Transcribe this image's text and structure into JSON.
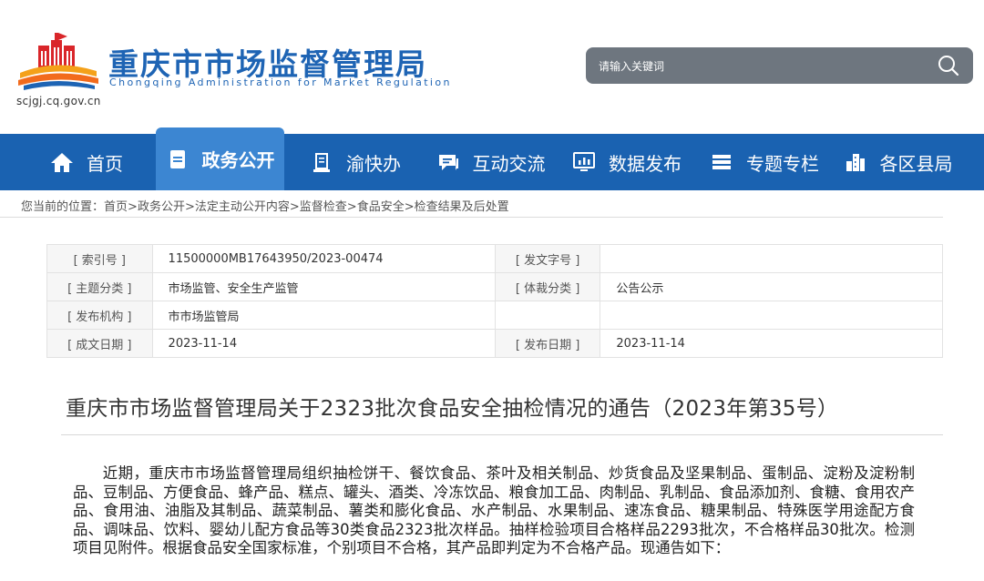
{
  "header": {
    "site_title": "重庆市市场监督管理局",
    "site_subtitle": "Chongqing Administration for Market Regulation",
    "site_url": "scjgj.cq.gov.cn",
    "search_placeholder": "请输入关键词",
    "search_icon": "search-icon"
  },
  "nav": {
    "items": [
      {
        "label": "首页",
        "icon": "home-icon"
      },
      {
        "label": "政务公开",
        "icon": "document-icon",
        "active": true
      },
      {
        "label": "渝快办",
        "icon": "book-icon"
      },
      {
        "label": "互动交流",
        "icon": "chat-icon"
      },
      {
        "label": "数据发布",
        "icon": "monitor-chart-icon"
      },
      {
        "label": "专题专栏",
        "icon": "list-icon"
      },
      {
        "label": "各区县局",
        "icon": "buildings-icon"
      }
    ]
  },
  "breadcrumb": {
    "prefix": "您当前的位置：",
    "items": [
      "首页",
      "政务公开",
      "法定主动公开内容",
      "监督检查",
      "食品安全",
      "检查结果及后处置"
    ],
    "separator": ">"
  },
  "meta": {
    "index_label": "[ 索引号 ]",
    "index_value": "11500000MB17643950/2023-00474",
    "doc_no_label": "[ 发文字号 ]",
    "doc_no_value": "",
    "topic_label": "[ 主题分类 ]",
    "topic_value": "市场监管、安全生产监管",
    "genre_label": "[ 体裁分类 ]",
    "genre_value": "公告公示",
    "issuer_label": "[ 发布机构 ]",
    "issuer_value": "市市场监管局",
    "created_label": "[ 成文日期 ]",
    "created_value": "2023-11-14",
    "published_label": "[ 发布日期 ]",
    "published_value": "2023-11-14"
  },
  "article": {
    "title": "重庆市市场监督管理局关于2323批次食品安全抽检情况的通告（2023年第35号）",
    "paragraph": "近期，重庆市市场监督管理局组织抽检饼干、餐饮食品、茶叶及相关制品、炒货食品及坚果制品、蛋制品、淀粉及淀粉制品、豆制品、方便食品、蜂产品、糕点、罐头、酒类、冷冻饮品、粮食加工品、肉制品、乳制品、食品添加剂、食糖、食用农产品、食用油、油脂及其制品、蔬菜制品、薯类和膨化食品、水产制品、水果制品、速冻食品、糖果制品、特殊医学用途配方食品、调味品、饮料、婴幼儿配方食品等30类食品2323批次样品。抽样检验项目合格样品2293批次，不合格样品30批次。检测项目见附件。根据食品安全国家标准，个别项目不合格，其产品即判定为不合格产品。现通告如下："
  },
  "colors": {
    "brand_blue": "#1e64b4",
    "nav_bg": "#1a62b1",
    "nav_active": "#3c86d2",
    "search_bg": "#6e767f"
  }
}
